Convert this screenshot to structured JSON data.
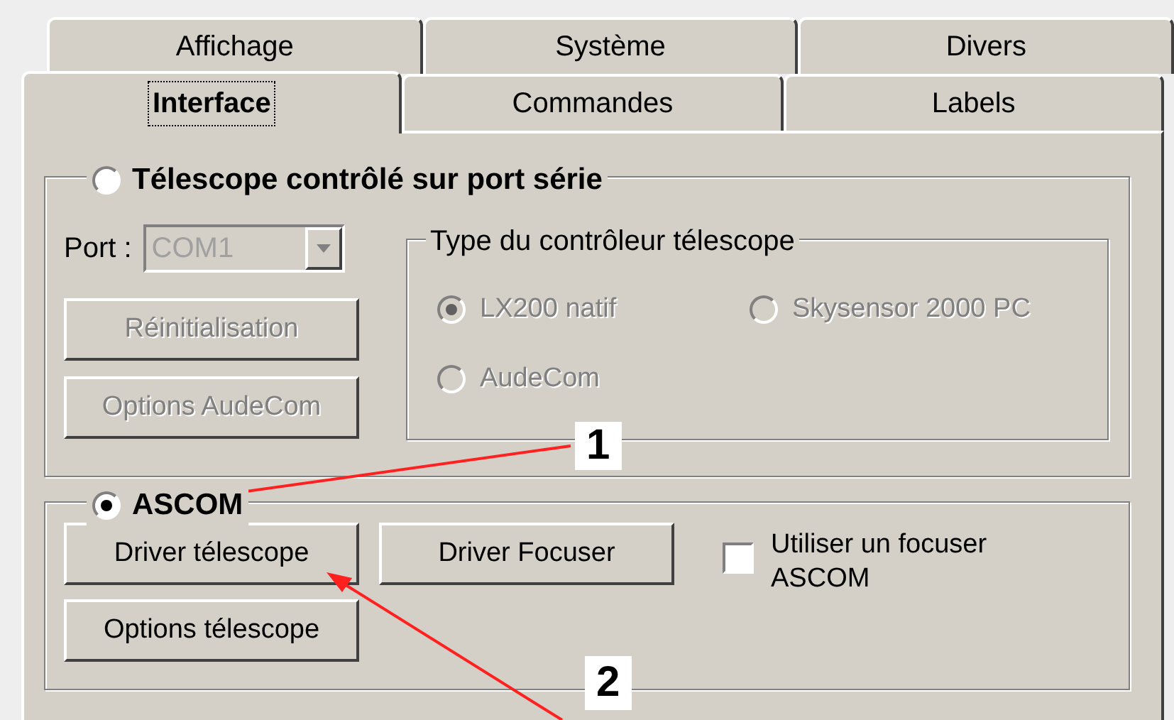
{
  "tabs_back": [
    {
      "label": "Affichage",
      "selected": false
    },
    {
      "label": "Système",
      "selected": false
    },
    {
      "label": "Divers",
      "selected": false
    }
  ],
  "tabs_front": [
    {
      "label": "Interface",
      "selected": true
    },
    {
      "label": "Commandes",
      "selected": false
    },
    {
      "label": "Labels",
      "selected": false
    }
  ],
  "serial_group": {
    "label": "Télescope contrôlé sur port série",
    "selected": false,
    "port_label": "Port :",
    "port_value": "COM1",
    "port_disabled": true,
    "buttons": [
      {
        "label": "Réinitialisation",
        "disabled": true
      },
      {
        "label": "Options AudeCom",
        "disabled": true
      }
    ],
    "controller_group": {
      "label": "Type du contrôleur télescope",
      "options": [
        {
          "label": "LX200 natif",
          "selected": true,
          "disabled": true
        },
        {
          "label": "Skysensor 2000 PC",
          "selected": false,
          "disabled": true
        },
        {
          "label": "AudeCom",
          "selected": false,
          "disabled": true
        }
      ]
    }
  },
  "ascom_group": {
    "label": "ASCOM",
    "selected": true,
    "buttons": [
      {
        "label": "Driver télescope",
        "disabled": false
      },
      {
        "label": "Driver Focuser",
        "disabled": false
      },
      {
        "label": "Options télescope",
        "disabled": false
      }
    ],
    "focuser_checkbox": {
      "label": "Utiliser un focuser ASCOM",
      "checked": false
    }
  },
  "annotations": [
    "1",
    "2"
  ]
}
